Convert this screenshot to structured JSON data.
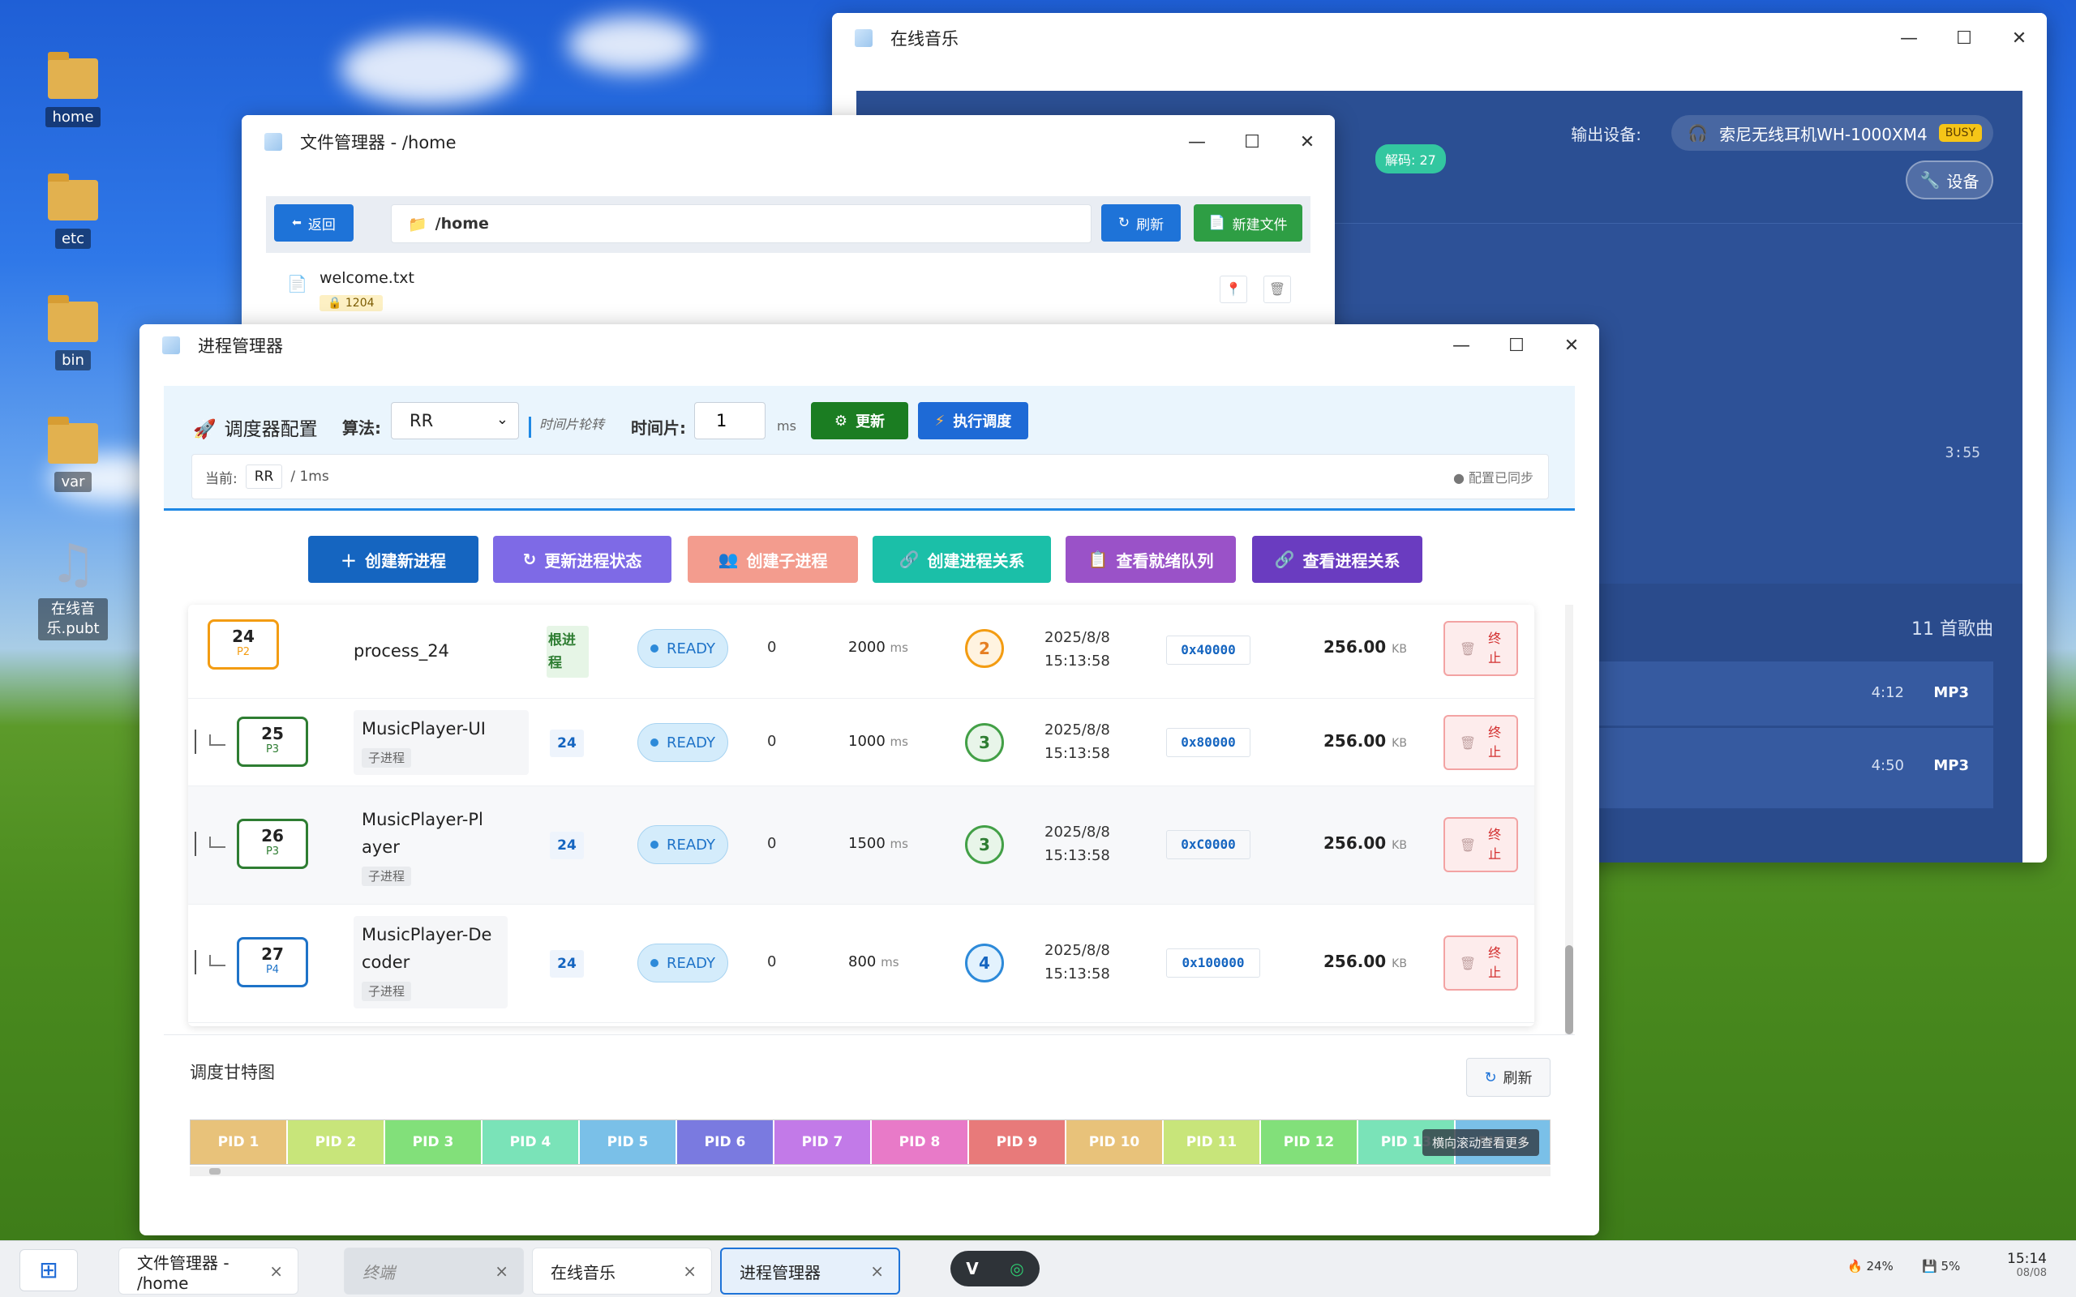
{
  "desktop": {
    "icons": [
      {
        "label": "home",
        "icon": "folder-icon"
      },
      {
        "label": "etc",
        "icon": "folder-icon"
      },
      {
        "label": "bin",
        "icon": "folder-icon"
      },
      {
        "label": "var",
        "icon": "folder-icon"
      },
      {
        "label": "在线音乐.pubt",
        "icon": "music-note-icon"
      }
    ]
  },
  "music_window": {
    "title": "在线音乐",
    "output_label": "输出设备:",
    "device_name": "索尼无线耳机WH-1000XM4",
    "device_badge": "BUSY",
    "settings_label": "设备",
    "decode_badge": "解码: 27",
    "time_total": "3:55",
    "song_count": "11 首歌曲",
    "songs": [
      {
        "duration": "4:12",
        "format": "MP3"
      },
      {
        "duration": "4:50",
        "format": "MP3"
      }
    ]
  },
  "file_manager": {
    "title": "文件管理器 - /home",
    "back_label": "返回",
    "path": "/home",
    "refresh_label": "刷新",
    "new_file_label": "新建文件",
    "files": [
      {
        "name": "welcome.txt",
        "size": "1204"
      }
    ]
  },
  "process_manager": {
    "title": "进程管理器",
    "config": {
      "title": "调度器配置",
      "algo_label": "算法:",
      "algo_value": "RR",
      "algo_hint": "时间片轮转",
      "slice_label": "时间片:",
      "slice_value": "1",
      "slice_unit": "ms",
      "update_label": "更新",
      "run_label": "执行调度",
      "current_label": "当前:",
      "current_algo": "RR",
      "current_slice": "/ 1ms",
      "sync_status": "● 配置已同步"
    },
    "actions": [
      {
        "label": "创建新进程",
        "color": "#1565c0",
        "icon": "＋"
      },
      {
        "label": "更新进程状态",
        "color": "#7e6ae6",
        "icon": "↻"
      },
      {
        "label": "创建子进程",
        "color": "#f39c8e",
        "icon": "👥"
      },
      {
        "label": "创建进程关系",
        "color": "#1bbfa8",
        "icon": "🔗"
      },
      {
        "label": "查看就绪队列",
        "color": "#9a52c8",
        "icon": "📋"
      },
      {
        "label": "查看进程关系",
        "color": "#6a3cc0",
        "icon": "🔗"
      }
    ],
    "processes": [
      {
        "pid": "24",
        "ptag": "P2",
        "name": "process_24",
        "relation": "根进程",
        "state": "READY",
        "count": "0",
        "burst": "2000",
        "burst_unit": "ms",
        "priority": "2",
        "time1": "2025/8/8",
        "time2": "15:13:58",
        "address": "0x40000",
        "memory": "256.00",
        "mem_unit": "KB",
        "kill1": "终",
        "kill2": "止",
        "color": "#f39c12"
      },
      {
        "pid": "25",
        "ptag": "P3",
        "name": "MusicPlayer-UI",
        "child": "子进程",
        "relation": "24",
        "state": "READY",
        "count": "0",
        "burst": "1000",
        "burst_unit": "ms",
        "priority": "3",
        "time1": "2025/8/8",
        "time2": "15:13:58",
        "address": "0x80000",
        "memory": "256.00",
        "mem_unit": "KB",
        "kill1": "终",
        "kill2": "止",
        "color": "#2e7d32"
      },
      {
        "pid": "26",
        "ptag": "P3",
        "name": "MusicPlayer-Player",
        "child": "子进程",
        "relation": "24",
        "state": "READY",
        "count": "0",
        "burst": "1500",
        "burst_unit": "ms",
        "priority": "3",
        "time1": "2025/8/8",
        "time2": "15:13:58",
        "address": "0xC0000",
        "memory": "256.00",
        "mem_unit": "KB",
        "kill1": "终",
        "kill2": "止",
        "color": "#2e7d32"
      },
      {
        "pid": "27",
        "ptag": "P4",
        "name": "MusicPlayer-Decoder",
        "child": "子进程",
        "relation": "24",
        "state": "READY",
        "count": "0",
        "burst": "800",
        "burst_unit": "ms",
        "priority": "4",
        "time1": "2025/8/8",
        "time2": "15:13:58",
        "address": "0x100000",
        "memory": "256.00",
        "mem_unit": "KB",
        "kill1": "终",
        "kill2": "止",
        "color": "#1e73c8"
      }
    ],
    "gantt": {
      "title": "调度甘特图",
      "refresh_label": "刷新",
      "scroll_hint": "横向滚动查看更多",
      "cells": [
        {
          "label": "PID 1",
          "color": "#e8c27a"
        },
        {
          "label": "PID 2",
          "color": "#c8e57a"
        },
        {
          "label": "PID 3",
          "color": "#82e07a"
        },
        {
          "label": "PID 4",
          "color": "#7ae3b8"
        },
        {
          "label": "PID 5",
          "color": "#7ac0e8"
        },
        {
          "label": "PID 6",
          "color": "#7a7ae0"
        },
        {
          "label": "PID 7",
          "color": "#c27ae8"
        },
        {
          "label": "PID 8",
          "color": "#e87ac8"
        },
        {
          "label": "PID 9",
          "color": "#e87a7a"
        },
        {
          "label": "PID 10",
          "color": "#e8c27a"
        },
        {
          "label": "PID 11",
          "color": "#c8e57a"
        },
        {
          "label": "PID 12",
          "color": "#82e07a"
        },
        {
          "label": "PID 13",
          "color": "#7ae3b8"
        },
        {
          "label": "PID 14",
          "color": "#7ac0e8"
        }
      ]
    }
  },
  "taskbar": {
    "tasks": [
      {
        "label": "文件管理器 - /home"
      },
      {
        "label": "终端"
      },
      {
        "label": "在线音乐"
      },
      {
        "label": "进程管理器"
      }
    ],
    "cpu": "24%",
    "disk": "5%",
    "time": "15:14",
    "date": "08/08"
  }
}
